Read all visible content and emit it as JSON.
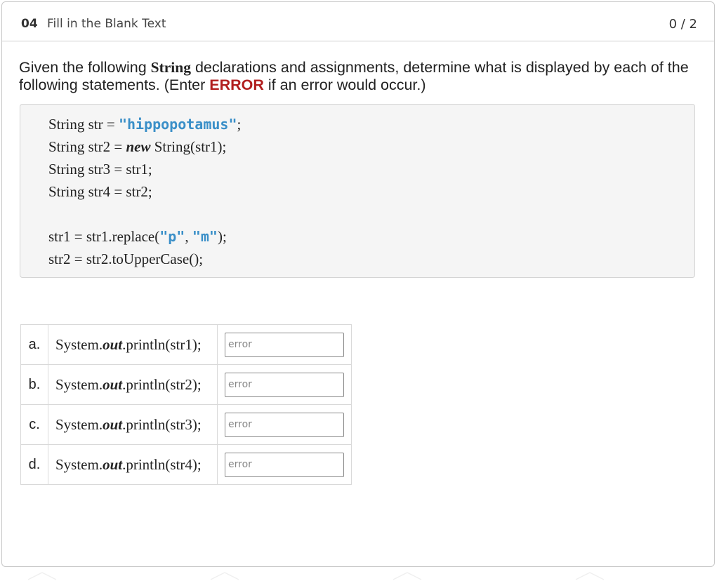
{
  "header": {
    "number": "04",
    "type": "Fill in the Blank Text",
    "score": "0 / 2"
  },
  "prompt": {
    "part1": "Given the following ",
    "string_word": "String",
    "part2": " declarations and assignments, determine what is displayed by each of the following statements. (Enter ",
    "error_word": "ERROR",
    "part3": " if an error would occur.)"
  },
  "code": {
    "line1_pre": "String str = ",
    "line1_lit": "\"hippopotamus\"",
    "line1_post": ";",
    "line2_pre": "String str2 = ",
    "line2_kw": "new",
    "line2_post": " String(str1);",
    "line3": "String str3 = str1;",
    "line4": "String str4 = str2;",
    "line5_pre": "str1 = str1.replace(",
    "line5_lit1": "\"p\"",
    "line5_mid": ", ",
    "line5_lit2": "\"m\"",
    "line5_post": ");",
    "line6": "str2 = str2.toUpperCase();"
  },
  "answers": [
    {
      "letter": "a.",
      "pre": "System.",
      "out": "out",
      "post": ".println(str1);",
      "value": "error"
    },
    {
      "letter": "b.",
      "pre": "System.",
      "out": "out",
      "post": ".println(str2);",
      "value": "error"
    },
    {
      "letter": "c.",
      "pre": "System.",
      "out": "out",
      "post": ".println(str3);",
      "value": "error"
    },
    {
      "letter": "d.",
      "pre": "System.",
      "out": "out",
      "post": ".println(str4);",
      "value": "error"
    }
  ]
}
